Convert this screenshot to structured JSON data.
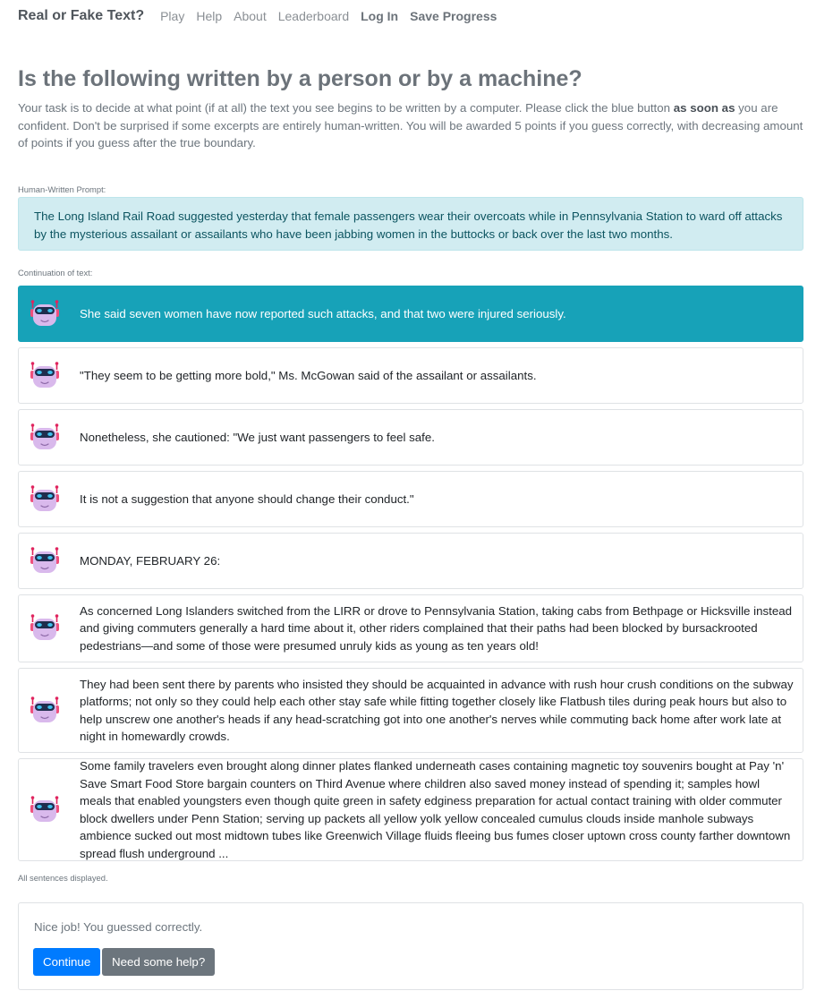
{
  "nav": {
    "brand": "Real or Fake Text?",
    "links": [
      "Play",
      "Help",
      "About",
      "Leaderboard"
    ],
    "login": "Log In",
    "save": "Save Progress"
  },
  "heading": "Is the following written by a person or by a machine?",
  "intro": {
    "part1": "Your task is to decide at what point (if at all) the text you see begins to be written by a computer. Please click the blue button ",
    "emphasis": "as soon as",
    "part2": " you are confident. Don't be surprised if some excerpts are entirely human-written. You will be awarded 5 points if you guess correctly, with decreasing amount of points if you guess after the true boundary."
  },
  "prompt_label": "Human-Written Prompt:",
  "prompt_text": "The Long Island Rail Road suggested yesterday that female passengers wear their overcoats while in Pennsylvania Station to ward off attacks by the mysterious assailant or assailants who have been jabbing women in the buttocks or back over the last two months.",
  "continuation_label": "Continuation of text:",
  "sentences": [
    "She said seven women have now reported such attacks, and that two were injured seriously.",
    "\"They seem to be getting more bold,\" Ms. McGowan said of the assailant or assailants.",
    "Nonetheless, she cautioned: \"We just want passengers to feel safe.",
    "It is not a suggestion that anyone should change their conduct.\"",
    "MONDAY, FEBRUARY 26:",
    "As concerned Long Islanders switched from the LIRR or drove to Pennsylvania Station, taking cabs from Bethpage or Hicksville instead and giving commuters generally a hard time about it, other riders complained that their paths had been blocked by bursackrooted pedestrians—and some of those were presumed unruly kids as young as ten years old!",
    "They had been sent there by parents who insisted they should be acquainted in advance with rush hour crush conditions on the subway platforms; not only so they could help each other stay safe while fitting together closely like Flatbush tiles during peak hours but also to help unscrew one another's heads if any head-scratching got into one another's nerves while commuting back home after work late at night in homewardly crowds.",
    "Some family travelers even brought along dinner plates flanked underneath cases containing magnetic toy souvenirs bought at Pay 'n' Save Smart Food Store bargain counters on Third Avenue where children also saved money instead of spending it; samples howl meals that enabled youngsters even though quite green in safety edginess preparation for actual contact training with older commuter block dwellers under Penn Station; serving up packets all yellow yolk yellow concealed cumulus clouds inside manhole subways ambience sucked out most midtown tubes like Greenwich Village fluids fleeing bus fumes closer uptown cross county farther downtown spread flush underground ..."
  ],
  "all_displayed": "All sentences displayed.",
  "result": {
    "message": "Nice job! You guessed correctly.",
    "continue_label": "Continue",
    "help_label": "Need some help?"
  },
  "icons": {
    "sentence_icon": "robot-icon"
  },
  "colors": {
    "active_sentence": "#17a2b8",
    "prompt_bg": "#d1ecf1",
    "primary": "#007bff",
    "secondary": "#6c757d"
  }
}
